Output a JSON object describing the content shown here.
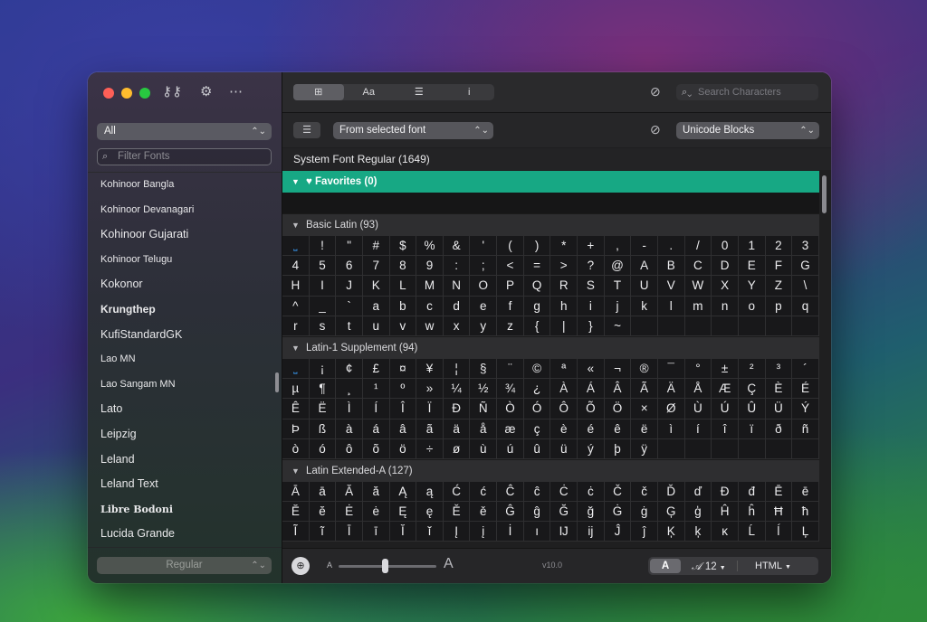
{
  "sidebar": {
    "category_select": "All",
    "filter_placeholder": "Filter Fonts",
    "fonts": [
      {
        "name": "Kohinoor Bangla",
        "style": ""
      },
      {
        "name": "Kohinoor Devanagari",
        "style": ""
      },
      {
        "name": "Kohinoor Gujarati",
        "style": "big"
      },
      {
        "name": "Kohinoor Telugu",
        "style": ""
      },
      {
        "name": "Kokonor",
        "style": "big"
      },
      {
        "name": "Krungthep",
        "style": "bold"
      },
      {
        "name": "KufiStandardGK",
        "style": "big"
      },
      {
        "name": "Lao MN",
        "style": ""
      },
      {
        "name": "Lao Sangam MN",
        "style": ""
      },
      {
        "name": "Lato",
        "style": "big"
      },
      {
        "name": "Leipzig",
        "style": "big"
      },
      {
        "name": "Leland",
        "style": "big"
      },
      {
        "name": "Leland Text",
        "style": "big"
      },
      {
        "name": "Libre Bodoni",
        "style": "serif"
      },
      {
        "name": "Lucida Grande",
        "style": "big"
      }
    ],
    "style_select": "Regular"
  },
  "toolbar": {
    "segments": [
      {
        "label": "⊞",
        "active": true
      },
      {
        "label": "Aa",
        "active": false
      },
      {
        "label": "☰",
        "active": false
      },
      {
        "label": "i",
        "active": false
      }
    ],
    "search_placeholder": "Search Characters"
  },
  "subbar": {
    "source_select": "From selected font",
    "blocks_select": "Unicode Blocks"
  },
  "header": "System Font Regular (1649)",
  "sections": [
    {
      "title": "Favorites (0)",
      "favorite": true,
      "chars": []
    },
    {
      "title": "Basic Latin (93)",
      "favorite": false,
      "chars": [
        "⎵",
        "!",
        "\"",
        "#",
        "$",
        "%",
        "&",
        "'",
        "(",
        ")",
        "*",
        "+",
        ",",
        "-",
        ".",
        "/",
        "0",
        "1",
        "2",
        "3",
        "4",
        "5",
        "6",
        "7",
        "8",
        "9",
        ":",
        ";",
        "<",
        "=",
        ">",
        "?",
        "@",
        "A",
        "B",
        "C",
        "D",
        "E",
        "F",
        "G",
        "H",
        "I",
        "J",
        "K",
        "L",
        "M",
        "N",
        "O",
        "P",
        "Q",
        "R",
        "S",
        "T",
        "U",
        "V",
        "W",
        "X",
        "Y",
        "Z",
        "\\",
        "^",
        "_",
        "`",
        "a",
        "b",
        "c",
        "d",
        "e",
        "f",
        "g",
        "h",
        "i",
        "j",
        "k",
        "l",
        "m",
        "n",
        "o",
        "p",
        "q",
        "r",
        "s",
        "t",
        "u",
        "v",
        "w",
        "x",
        "y",
        "z",
        "{",
        "|",
        "}",
        "~",
        "",
        "",
        "",
        "",
        "",
        "",
        ""
      ]
    },
    {
      "title": "Latin-1 Supplement (94)",
      "favorite": false,
      "chars": [
        "⎵",
        "¡",
        "¢",
        "£",
        "¤",
        "¥",
        "¦",
        "§",
        "¨",
        "©",
        "ª",
        "«",
        "¬",
        "®",
        "¯",
        "°",
        "±",
        "²",
        "³",
        "´",
        "µ",
        "¶",
        "¸",
        "¹",
        "º",
        "»",
        "¼",
        "½",
        "¾",
        "¿",
        "À",
        "Á",
        "Â",
        "Ã",
        "Ä",
        "Å",
        "Æ",
        "Ç",
        "È",
        "É",
        "Ê",
        "Ë",
        "Ì",
        "Í",
        "Î",
        "Ï",
        "Ð",
        "Ñ",
        "Ò",
        "Ó",
        "Ô",
        "Õ",
        "Ö",
        "×",
        "Ø",
        "Ù",
        "Ú",
        "Û",
        "Ü",
        "Ý",
        "Þ",
        "ß",
        "à",
        "á",
        "â",
        "ã",
        "ä",
        "å",
        "æ",
        "ç",
        "è",
        "é",
        "ê",
        "ë",
        "ì",
        "í",
        "î",
        "ï",
        "ð",
        "ñ",
        "ò",
        "ó",
        "ô",
        "õ",
        "ö",
        "÷",
        "ø",
        "ù",
        "ú",
        "û",
        "ü",
        "ý",
        "þ",
        "ÿ",
        "",
        "",
        "",
        "",
        "",
        ""
      ]
    },
    {
      "title": "Latin Extended-A (127)",
      "favorite": false,
      "chars": [
        "Ā",
        "ā",
        "Ă",
        "ă",
        "Ą",
        "ą",
        "Ć",
        "ć",
        "Ĉ",
        "ĉ",
        "Ċ",
        "ċ",
        "Č",
        "č",
        "Ď",
        "ď",
        "Đ",
        "đ",
        "Ē",
        "ē",
        "Ĕ",
        "ĕ",
        "Ė",
        "ė",
        "Ę",
        "ę",
        "Ě",
        "ě",
        "Ĝ",
        "ĝ",
        "Ğ",
        "ğ",
        "Ġ",
        "ġ",
        "Ģ",
        "ģ",
        "Ĥ",
        "ĥ",
        "Ħ",
        "ħ",
        "Ĩ",
        "ĩ",
        "Ī",
        "ī",
        "Ĭ",
        "ĭ",
        "Į",
        "į",
        "İ",
        "ı",
        "Ĳ",
        "ĳ",
        "Ĵ",
        "ĵ",
        "Ķ",
        "ķ",
        "ĸ",
        "Ĺ",
        "ĺ",
        "Ļ"
      ]
    }
  ],
  "bottombar": {
    "small_a": "A",
    "big_a": "A",
    "version": "v10.0",
    "bold_a": "A",
    "size_script": "𝒜",
    "size": "12",
    "format": "HTML"
  }
}
